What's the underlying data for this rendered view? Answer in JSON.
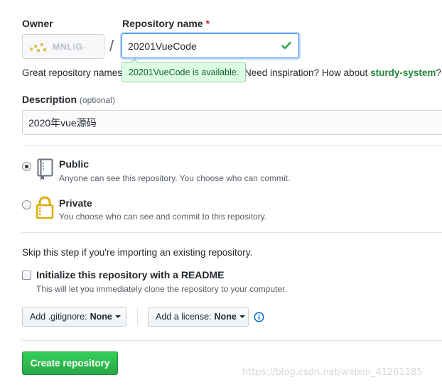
{
  "owner": {
    "label": "Owner",
    "name": "MNLIG·"
  },
  "separator": "/",
  "repo_name": {
    "label": "Repository name",
    "required_marker": "*",
    "value": "20201VueCode",
    "status_icon": "check-icon",
    "availability_tip": "20201VueCode is available."
  },
  "inspiration": {
    "prefix": "Great repository names",
    "question": "Need inspiration? How about",
    "suggestion": "sturdy-system",
    "suffix": "?"
  },
  "description": {
    "label": "Description",
    "optional": "(optional)",
    "value": "2020年vue源码"
  },
  "visibility": {
    "selected": "public",
    "options": [
      {
        "key": "public",
        "title": "Public",
        "note": "Anyone can see this repository. You choose who can commit.",
        "icon": "repo-book-icon"
      },
      {
        "key": "private",
        "title": "Private",
        "note": "You choose who can see and commit to this repository.",
        "icon": "lock-icon"
      }
    ]
  },
  "import_hint": "Skip this step if you're importing an existing repository.",
  "init_readme": {
    "label": "Initialize this repository with a README",
    "note": "This will let you immediately clone the repository to your computer.",
    "checked": false
  },
  "gitignore": {
    "prefix": "Add .gitignore:",
    "value": "None"
  },
  "license": {
    "prefix": "Add a license:",
    "value": "None"
  },
  "info_icon": "info-icon",
  "create_button": "Create repository",
  "watermark": "https://blog.csdn.net/weixin_41261185",
  "colors": {
    "accent_blue": "#0366d6",
    "success_green": "#28a745",
    "tip_bg": "#dcffe4",
    "required_red": "#cb2431"
  }
}
